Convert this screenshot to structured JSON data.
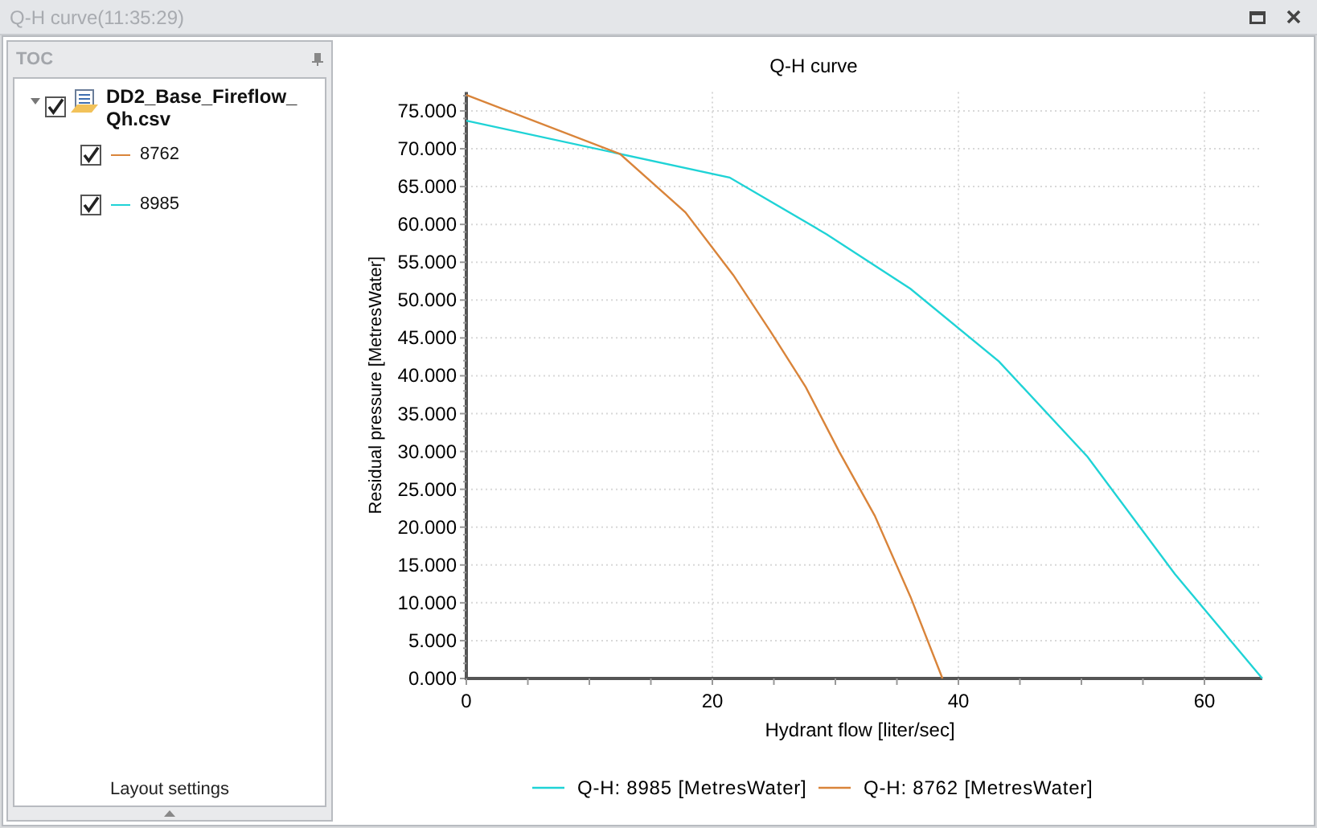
{
  "window": {
    "title": "Q-H curve(11:35:29)"
  },
  "toc": {
    "title": "TOC",
    "footer": "Layout settings",
    "tree": [
      {
        "label": "DD2_Base_Fireflow_Qh.csv",
        "checked": true,
        "expanded": true,
        "children": [
          {
            "label": "8762",
            "checked": true,
            "color": "#d9843a"
          },
          {
            "label": "8985",
            "checked": true,
            "color": "#1fd3d6"
          }
        ]
      }
    ]
  },
  "chart": {
    "chart_data": {
      "type": "line",
      "title": "Q-H curve",
      "xlabel": "Hydrant flow [liter/sec]",
      "ylabel": "Residual pressure [MetresWater]",
      "grid": true,
      "legend": true,
      "xlim": [
        0,
        64.7
      ],
      "ylim": [
        0,
        77.5
      ],
      "xticks": [
        0,
        20,
        40,
        60
      ],
      "yticks": [
        {
          "value": 0,
          "label": "0.000"
        },
        {
          "value": 5,
          "label": "5.000"
        },
        {
          "value": 10,
          "label": "10.000"
        },
        {
          "value": 15,
          "label": "15.000"
        },
        {
          "value": 20,
          "label": "20.000"
        },
        {
          "value": 25,
          "label": "25.000"
        },
        {
          "value": 30,
          "label": "30.000"
        },
        {
          "value": 35,
          "label": "35.000"
        },
        {
          "value": 40,
          "label": "40.000"
        },
        {
          "value": 45,
          "label": "45.000"
        },
        {
          "value": 50,
          "label": "50.000"
        },
        {
          "value": 55,
          "label": "55.000"
        },
        {
          "value": 60,
          "label": "60.000"
        },
        {
          "value": 65,
          "label": "65.000"
        },
        {
          "value": 70,
          "label": "70.000"
        },
        {
          "value": 75,
          "label": "75.000"
        }
      ],
      "series": [
        {
          "name": "Q-H: 8985 [MetresWater]",
          "color": "#1fd3d6",
          "x": [
            0,
            21.4,
            29.3,
            36.1,
            43.3,
            50.5,
            57.6,
            64.7
          ],
          "values": [
            73.7,
            66.2,
            58.7,
            51.5,
            41.9,
            29.3,
            13.8,
            0
          ]
        },
        {
          "name": "Q-H: 8762 [MetresWater]",
          "color": "#d9843a",
          "x": [
            0,
            12.5,
            17.8,
            21.7,
            24.7,
            27.6,
            30.3,
            33.2,
            36.1,
            38.7
          ],
          "values": [
            77.1,
            69.3,
            61.6,
            53.3,
            45.9,
            38.5,
            30.0,
            21.5,
            10.8,
            0
          ]
        }
      ]
    }
  }
}
